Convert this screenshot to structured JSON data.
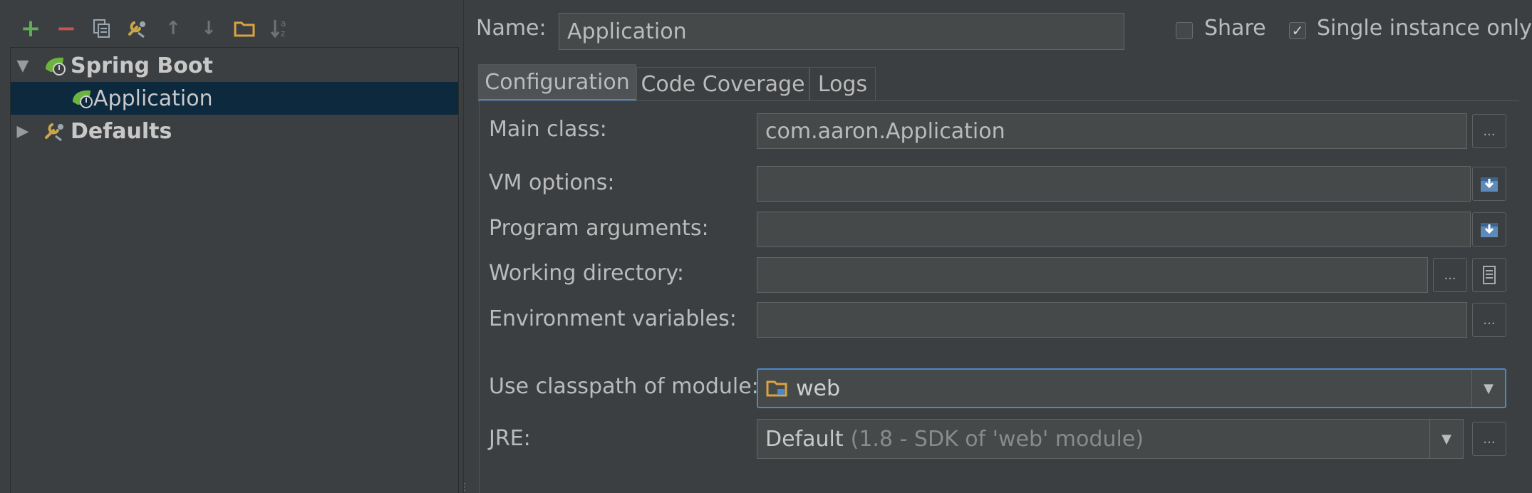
{
  "toolbar": {
    "add_icon": "+",
    "remove_icon": "−",
    "copy_icon": "copy",
    "edit_defaults_icon": "wrench",
    "move_up_icon": "↑",
    "move_down_icon": "↓",
    "folder_icon": "folder",
    "sort_icon": "sort-az"
  },
  "tree": {
    "groups": [
      {
        "label": "Spring Boot",
        "expanded": true,
        "children": [
          {
            "label": "Application",
            "selected": true
          }
        ]
      },
      {
        "label": "Defaults",
        "expanded": false,
        "children": []
      }
    ]
  },
  "header": {
    "name_label": "Name:",
    "name_value": "Application",
    "share_label": "Share",
    "share_checked": false,
    "single_instance_label": "Single instance only",
    "single_instance_checked": true
  },
  "tabs": [
    {
      "label": "Configuration",
      "active": true
    },
    {
      "label": "Code Coverage",
      "active": false
    },
    {
      "label": "Logs",
      "active": false
    }
  ],
  "form": {
    "main_class_label": "Main class:",
    "main_class_value": "com.aaron.Application",
    "vm_options_label": "VM options:",
    "vm_options_value": "",
    "program_args_label": "Program arguments:",
    "program_args_value": "",
    "working_dir_label": "Working directory:",
    "working_dir_value": "",
    "env_vars_label": "Environment variables:",
    "env_vars_value": "",
    "classpath_label": "Use classpath of module:",
    "classpath_value": "web",
    "jre_label": "JRE:",
    "jre_value": "Default",
    "jre_hint": "(1.8 - SDK of 'web' module)",
    "browse_label": "...",
    "dropdown_glyph": "▼"
  },
  "colors": {
    "background": "#3c3f41",
    "field": "#45494a",
    "selection": "#0d293e",
    "accent": "#4a88c7",
    "add_green": "#5fad56",
    "remove_red": "#c75450",
    "spring_green": "#6db33f"
  }
}
